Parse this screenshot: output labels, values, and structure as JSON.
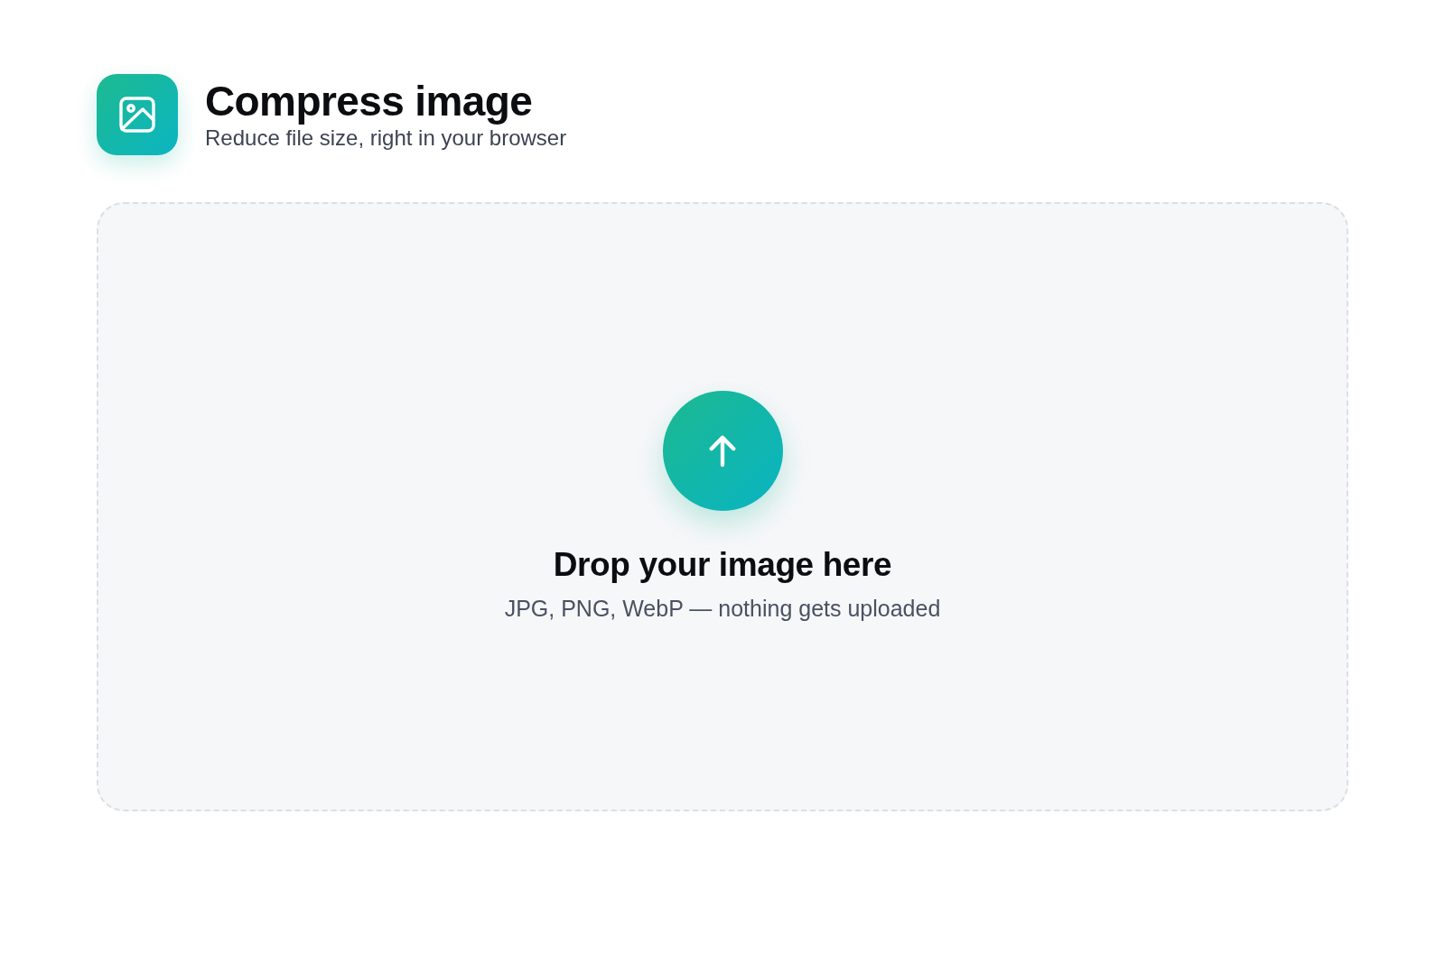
{
  "header": {
    "title": "Compress image",
    "subtitle": "Reduce file size, right in your browser"
  },
  "dropzone": {
    "title": "Drop your image here",
    "hint": "JPG, PNG, WebP — nothing gets uploaded"
  }
}
